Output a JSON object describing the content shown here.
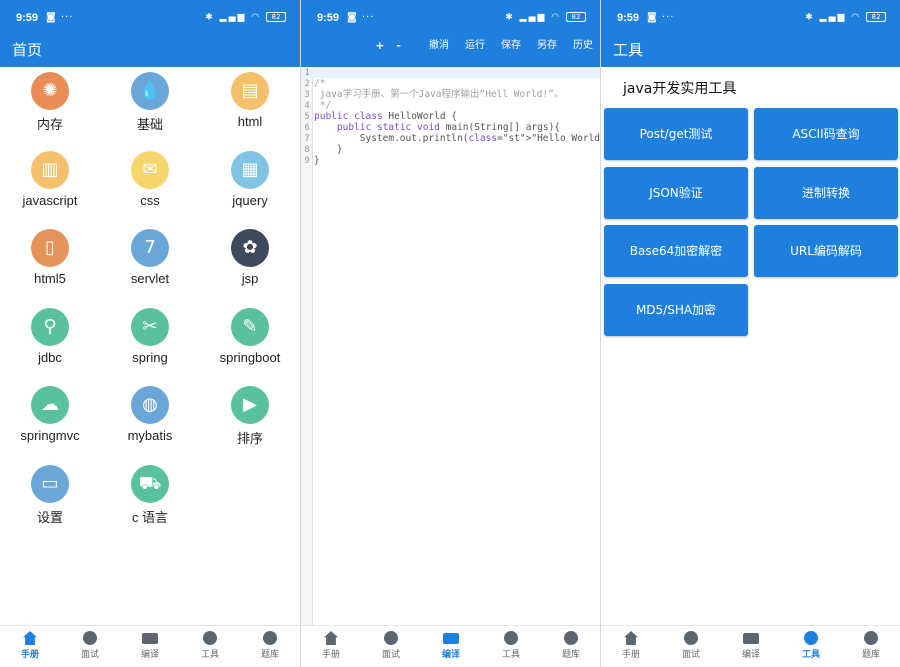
{
  "status": {
    "time": "9:59",
    "battery": "82"
  },
  "screen1": {
    "title": "首页",
    "items": [
      {
        "label": "内存",
        "icon": "sun-icon",
        "color": "#e98c55"
      },
      {
        "label": "基础",
        "icon": "droplet-icon",
        "color": "#6aa7d8"
      },
      {
        "label": "html",
        "icon": "document-icon",
        "color": "#f5c06b"
      },
      {
        "label": "javascript",
        "icon": "map-icon",
        "color": "#f5c06b"
      },
      {
        "label": "css",
        "icon": "envelope-icon",
        "color": "#f7d66b"
      },
      {
        "label": "jquery",
        "icon": "calendar-board-icon",
        "color": "#7fc4e2"
      },
      {
        "label": "html5",
        "icon": "phone-icon",
        "color": "#e4935b"
      },
      {
        "label": "servlet",
        "icon": "calendar-icon",
        "color": "#6aa7d8"
      },
      {
        "label": "jsp",
        "icon": "flower-icon",
        "color": "#3d4a5c"
      },
      {
        "label": "jdbc",
        "icon": "bicycle-icon",
        "color": "#59c1a0"
      },
      {
        "label": "spring",
        "icon": "tools-icon",
        "color": "#59c1a0"
      },
      {
        "label": "springboot",
        "icon": "notepad-icon",
        "color": "#59c1a0"
      },
      {
        "label": "springmvc",
        "icon": "cloud-upload-icon",
        "color": "#59c1a0"
      },
      {
        "label": "mybatis",
        "icon": "globe-icon",
        "color": "#6aa7d8"
      },
      {
        "label": "排序",
        "icon": "video-camera-icon",
        "color": "#59c1a0"
      },
      {
        "label": "设置",
        "icon": "battery-icon",
        "color": "#6aa7d8"
      },
      {
        "label": "c 语言",
        "icon": "hand-truck-icon",
        "color": "#59c1a0"
      }
    ]
  },
  "screen2": {
    "toolbar": [
      "+",
      "-",
      "撤消",
      "运行",
      "保存",
      "另存",
      "历史"
    ],
    "code_lines": [
      {
        "n": "1",
        "text": ""
      },
      {
        "n": "2",
        "text": "/*"
      },
      {
        "n": "3",
        "text": " java学习手册、第一个Java程序输出“Hell World!”。"
      },
      {
        "n": "4",
        "text": " */"
      },
      {
        "n": "5",
        "text": "public class HelloWorld {"
      },
      {
        "n": "6",
        "text": "    public static void main(String[] args){"
      },
      {
        "n": "7",
        "text": "        System.out.println(\"Hello World!\");"
      },
      {
        "n": "8",
        "text": "    }"
      },
      {
        "n": "9",
        "text": "}"
      }
    ]
  },
  "screen3": {
    "title": "工具",
    "heading": "java开发实用工具",
    "buttons": [
      "Post/get测试",
      "ASCII码查询",
      "JSON验证",
      "进制转换",
      "Base64加密解密",
      "URL编码解码",
      "MD5/SHA加密"
    ]
  },
  "nav": [
    "手册",
    "面试",
    "编译",
    "工具",
    "题库"
  ],
  "colors": {
    "primary": "#1e7fdc"
  }
}
